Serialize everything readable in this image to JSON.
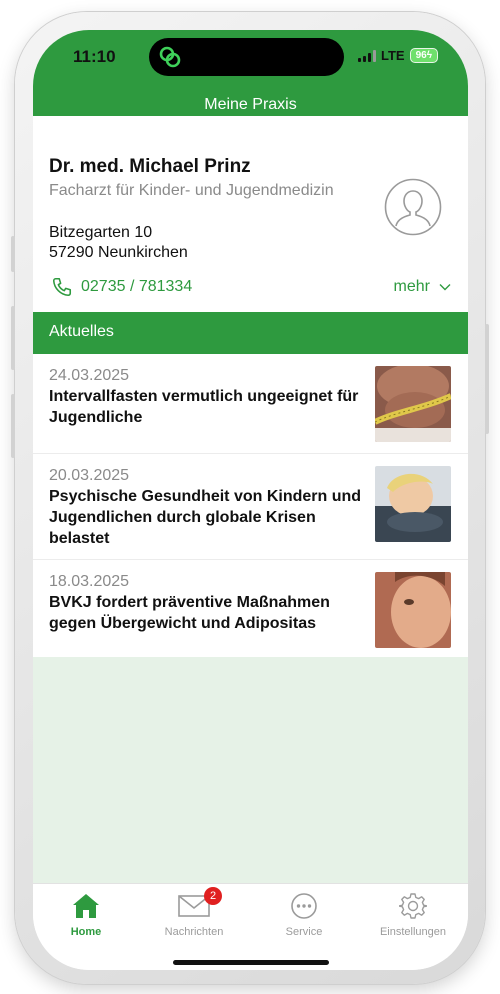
{
  "status": {
    "time": "11:10",
    "network": "LTE",
    "battery": "96"
  },
  "header": {
    "title": "Meine Praxis"
  },
  "doctor": {
    "name": "Dr. med. Michael Prinz",
    "specialty": "Facharzt für Kinder- und Jugendmedizin",
    "street": "Bitzegarten  10",
    "city": "57290 Neunkirchen",
    "phone": "02735 / 781334",
    "more_label": "mehr"
  },
  "news": {
    "section_title": "Aktuelles",
    "items": [
      {
        "date": "24.03.2025",
        "title": "Intervallfasten vermutlich ungeeignet für Jugendliche"
      },
      {
        "date": "20.03.2025",
        "title": "Psychische Gesundheit von Kindern und Jugendlichen durch globale Krisen belastet"
      },
      {
        "date": "18.03.2025",
        "title": "BVKJ fordert präventive Maßnahmen gegen Übergewicht und Adipositas"
      }
    ]
  },
  "tabbar": {
    "tabs": [
      {
        "label": "Home",
        "icon": "home-icon",
        "active": true
      },
      {
        "label": "Nachrichten",
        "icon": "mail-icon",
        "badge": "2"
      },
      {
        "label": "Service",
        "icon": "more-icon"
      },
      {
        "label": "Einstellungen",
        "icon": "gear-icon"
      }
    ]
  },
  "colors": {
    "brand": "#2e9a3f",
    "badge": "#e02020",
    "background": "#e6f2e7"
  }
}
